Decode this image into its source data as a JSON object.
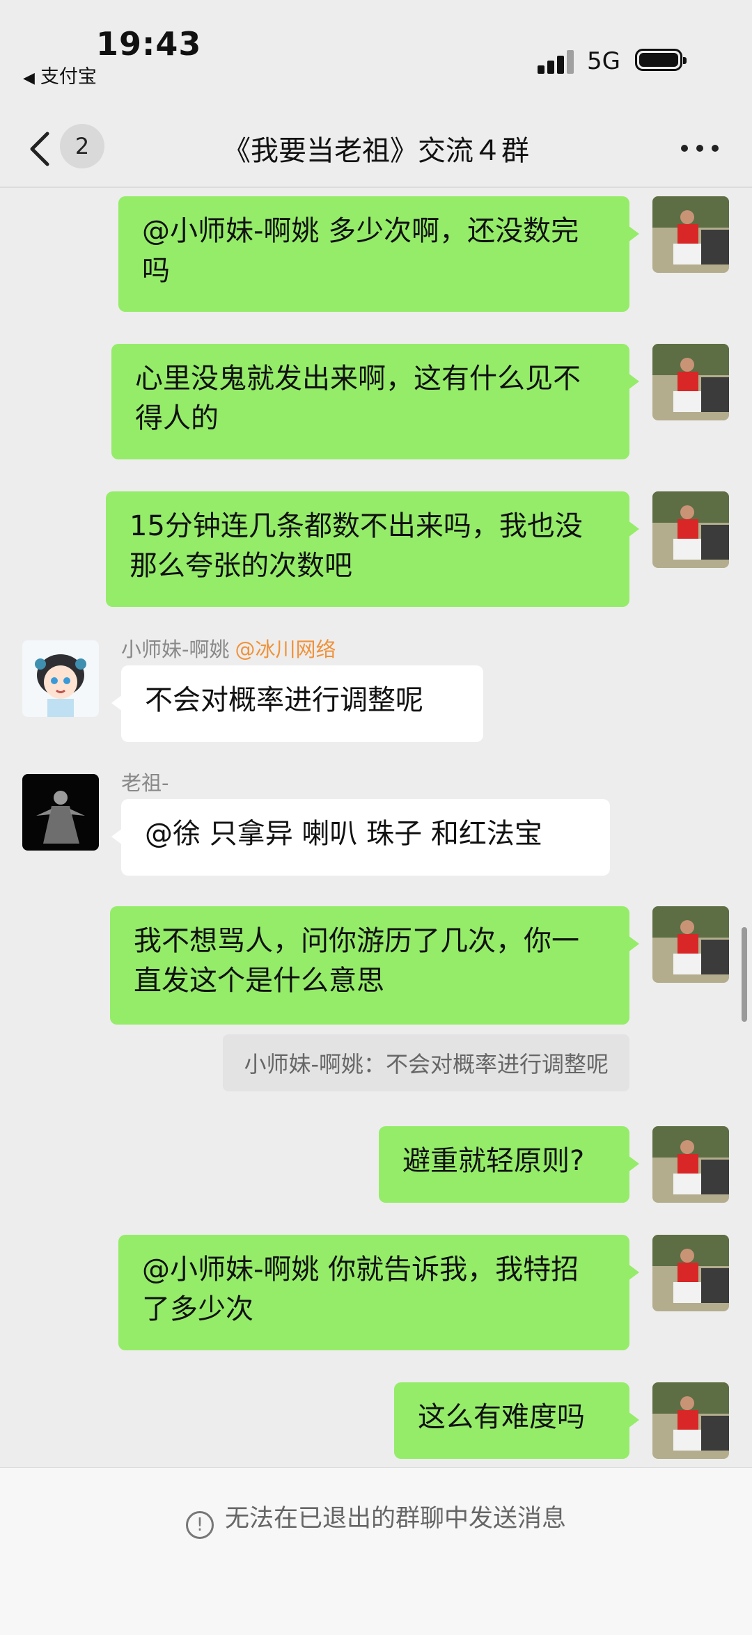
{
  "status_bar": {
    "time": "19:43",
    "back_app": "支付宝",
    "network": "5G"
  },
  "nav": {
    "unread_count": "2",
    "title": "《我要当老祖》交流４群"
  },
  "senders": {
    "xiaoshimei": "小师妹-啊姚",
    "laozu": "老祖-"
  },
  "messages": [
    {
      "text": "@小师妹-啊姚 多少次啊，还没数完吗"
    },
    {
      "text": "心里没鬼就发出来啊，这有什么见不得人的"
    },
    {
      "text": "15分钟连几条都数不出来吗，我也没那么夸张的次数吧"
    },
    {
      "text": "不会对概率进行调整呢",
      "mention": "@冰川网络"
    },
    {
      "text": "@徐 只拿异 喇叭 珠子 和红法宝"
    },
    {
      "text": "我不想骂人，问你游历了几次，你一直发这个是什么意思",
      "quote": "小师妹-啊姚：不会对概率进行调整呢"
    },
    {
      "text": "避重就轻原则?"
    },
    {
      "text": "@小师妹-啊姚 你就告诉我，我特招了多少次"
    },
    {
      "text": "这么有难度吗"
    }
  ],
  "footer": {
    "notice": "无法在已退出的群聊中发送消息"
  },
  "colors": {
    "bubble_self": "#95ec69",
    "bubble_other": "#ffffff",
    "mention": "#f0923a",
    "background": "#ededed"
  }
}
